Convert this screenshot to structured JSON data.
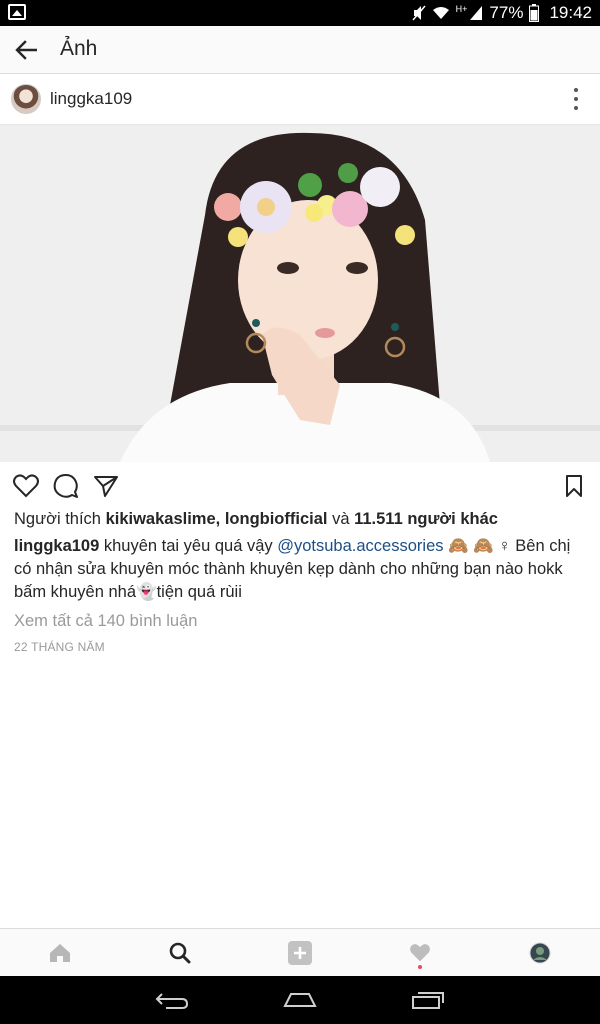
{
  "status_bar": {
    "battery": "77%",
    "time": "19:42",
    "network": "H+"
  },
  "app_bar": {
    "title": "Ảnh"
  },
  "post": {
    "username": "linggka109",
    "likes": {
      "prefix": "Người thích ",
      "names": "kikiwakaslime, longbiofficial",
      "conjunction": " và ",
      "others": "11.511 người khác"
    },
    "caption": {
      "username": "linggka109",
      "text_1": " khuyên tai yêu quá vậy ",
      "mention": "@yotsuba.accessories",
      "emoji_1": " 🙈 🙈 ",
      "text_2": " ♀ Bên chị có nhận sửa khuyên móc thành khuyên kẹp dành cho những bạn nào hokk bấm khuyên nhá",
      "emoji_2": "👻",
      "text_3": "tiện quá rùii"
    },
    "view_comments": "Xem tất cả 140 bình luận",
    "date": "22 THÁNG NĂM"
  },
  "icons": {
    "back": "arrow-left-icon",
    "more": "vertical-dots-icon",
    "like": "heart-outline-icon",
    "comment": "comment-bubble-icon",
    "share": "paper-plane-icon",
    "save": "bookmark-icon",
    "home": "home-icon",
    "search": "search-icon",
    "add": "plus-square-icon",
    "activity": "heart-icon",
    "profile": "profile-avatar-icon"
  },
  "colors": {
    "mention": "#1c4f86",
    "muted": "#9a9a9a",
    "notification_dot": "#ed4956"
  }
}
